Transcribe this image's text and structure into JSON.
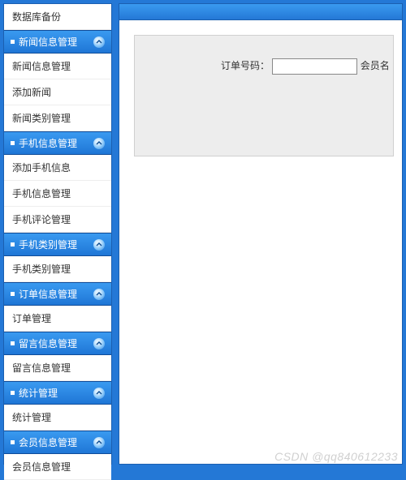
{
  "sidebar": {
    "topItems": [
      "数据库备份"
    ],
    "sections": [
      {
        "header": "新闻信息管理",
        "items": [
          "新闻信息管理",
          "添加新闻",
          "新闻类别管理"
        ]
      },
      {
        "header": "手机信息管理",
        "items": [
          "添加手机信息",
          "手机信息管理",
          "手机评论管理"
        ]
      },
      {
        "header": "手机类别管理",
        "items": [
          "手机类别管理"
        ]
      },
      {
        "header": "订单信息管理",
        "items": [
          "订单管理"
        ]
      },
      {
        "header": "留言信息管理",
        "items": [
          "留言信息管理"
        ]
      },
      {
        "header": "统计管理",
        "items": [
          "统计管理"
        ]
      },
      {
        "header": "会员信息管理",
        "items": [
          "会员信息管理"
        ]
      }
    ]
  },
  "form": {
    "orderNoLabel": "订单号码：",
    "orderNoValue": "",
    "memberNameLabel": "会员名"
  },
  "watermark": "CSDN @qq840612233"
}
